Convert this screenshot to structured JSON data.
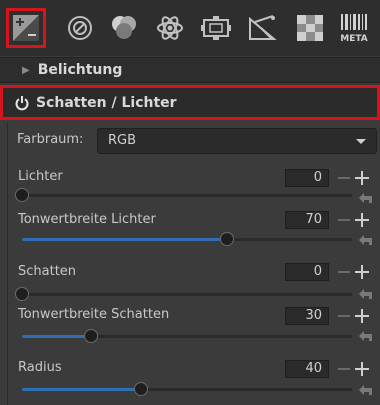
{
  "toolbar": {
    "tools": [
      {
        "name": "exposure-icon",
        "selected": true
      },
      {
        "name": "detail-icon",
        "selected": false
      },
      {
        "name": "color-icon",
        "selected": false
      },
      {
        "name": "advanced-icon",
        "selected": false
      },
      {
        "name": "transform-icon",
        "selected": false
      },
      {
        "name": "raw-icon",
        "selected": false
      },
      {
        "name": "color-management-icon",
        "selected": false
      },
      {
        "name": "metadata-icon",
        "selected": false
      }
    ],
    "meta_label": "META"
  },
  "sections": {
    "belichtung": {
      "title": "Belichtung",
      "expanded": false
    },
    "schatten_lichter": {
      "title": "Schatten / Lichter",
      "expanded": true
    }
  },
  "panel": {
    "farbraum": {
      "label": "Farbraum:",
      "value": "RGB"
    },
    "sliders": [
      {
        "label": "Lichter",
        "value": "0",
        "fraction": 0.0
      },
      {
        "label": "Tonwertbreite Lichter",
        "value": "70",
        "fraction": 0.62
      },
      {
        "label": "Schatten",
        "value": "0",
        "fraction": 0.0
      },
      {
        "label": "Tonwertbreite Schatten",
        "value": "30",
        "fraction": 0.21
      },
      {
        "label": "Radius",
        "value": "40",
        "fraction": 0.36
      }
    ]
  },
  "colors": {
    "accent": "#2f6fb7",
    "highlight_outline": "#d6141b"
  }
}
